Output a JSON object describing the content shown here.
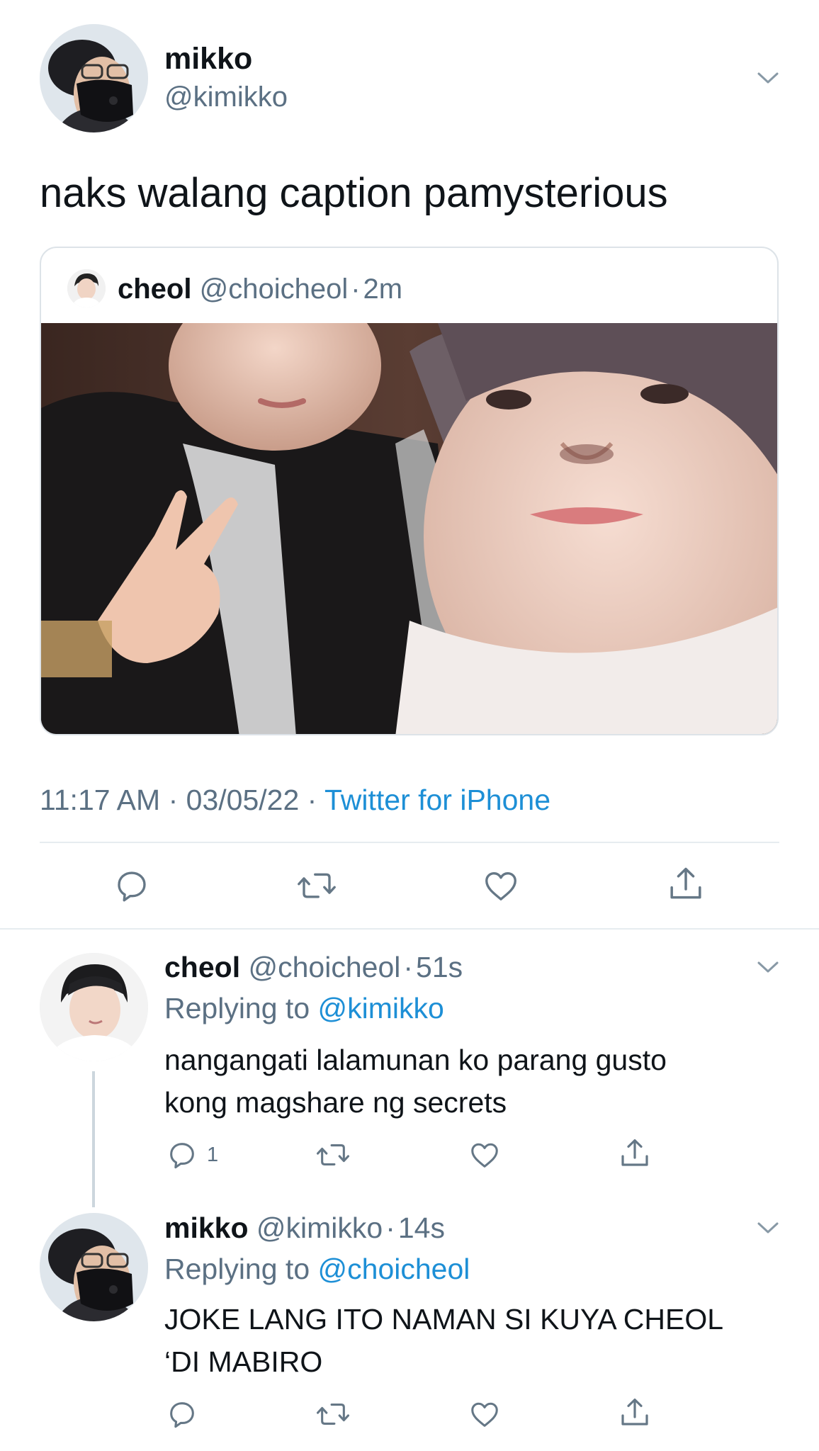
{
  "main_tweet": {
    "display_name": "mikko",
    "handle": "@kimikko",
    "text": "naks walang caption pamysterious",
    "timestamp": "11:17 AM",
    "date": "03/05/22",
    "source": "Twitter for iPhone",
    "separator": "·"
  },
  "quoted_tweet": {
    "display_name": "cheol",
    "handle": "@choicheol",
    "time": "2m",
    "separator": "·"
  },
  "replies": [
    {
      "display_name": "cheol",
      "handle": "@choicheol",
      "time": "51s",
      "separator": "·",
      "replying_prefix": "Replying to",
      "replying_to": "@kimikko",
      "text_line1": "nangangati lalamunan ko parang gusto",
      "text_line2": "kong magshare ng secrets",
      "reply_count": "1"
    },
    {
      "display_name": "mikko",
      "handle": "@kimikko",
      "time": "14s",
      "separator": "·",
      "replying_prefix": "Replying to",
      "replying_to": "@choicheol",
      "text_line1": "JOKE LANG ITO NAMAN SI KUYA CHEOL",
      "text_line2": "‘DI MABIRO",
      "reply_count": ""
    }
  ],
  "icons": {
    "reply": "speech-bubble-icon",
    "retweet": "retweet-arrows-icon",
    "like": "heart-icon",
    "share": "share-upload-icon",
    "more": "chevron-down-icon"
  },
  "colors": {
    "link_blue": "#1d8fd6",
    "secondary_grey": "#5b7083",
    "text_black": "#0f1419",
    "divider": "#e6ecf0"
  }
}
